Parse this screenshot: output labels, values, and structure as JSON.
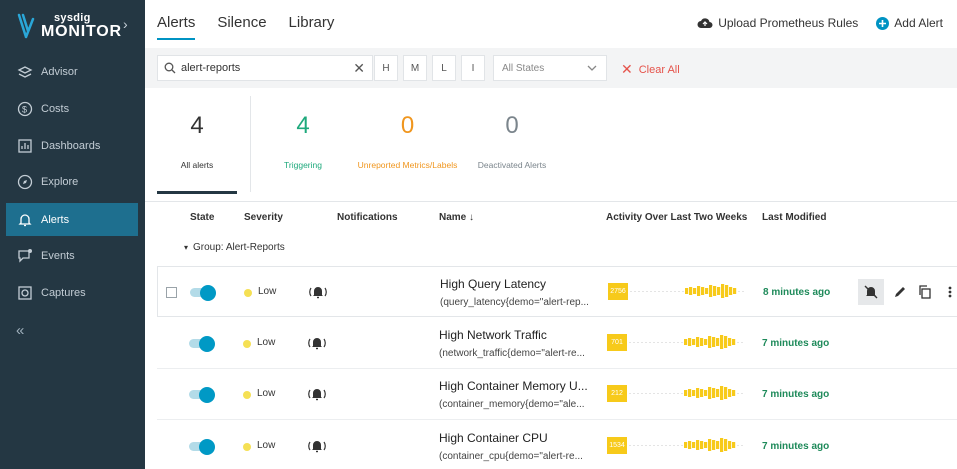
{
  "sidebar": {
    "brand_small": "sysdig",
    "brand_big": "MONITOR",
    "items": [
      {
        "label": "Advisor",
        "icon": "advisor-icon"
      },
      {
        "label": "Costs",
        "icon": "costs-icon"
      },
      {
        "label": "Dashboards",
        "icon": "dashboards-icon"
      },
      {
        "label": "Explore",
        "icon": "explore-icon"
      },
      {
        "label": "Alerts",
        "icon": "bell-icon",
        "active": true
      },
      {
        "label": "Events",
        "icon": "events-icon"
      },
      {
        "label": "Captures",
        "icon": "captures-icon"
      }
    ],
    "collapse": "«"
  },
  "tabs": [
    {
      "label": "Alerts",
      "active": true
    },
    {
      "label": "Silence"
    },
    {
      "label": "Library"
    }
  ],
  "actions": {
    "upload": "Upload Prometheus Rules",
    "add": "Add Alert"
  },
  "filters": {
    "search_value": "alert-reports",
    "severity_buttons": [
      "H",
      "M",
      "L",
      "I"
    ],
    "states_placeholder": "All States",
    "clear_all": "Clear All"
  },
  "summary": {
    "all": {
      "count": "4",
      "label": "All alerts"
    },
    "triggering": {
      "count": "4",
      "label": "Triggering"
    },
    "unreported": {
      "count": "0",
      "label": "Unreported Metrics/Labels"
    },
    "deactivated": {
      "count": "0",
      "label": "Deactivated Alerts"
    }
  },
  "table": {
    "headers": {
      "state": "State",
      "severity": "Severity",
      "notifications": "Notifications",
      "name": "Name ↓",
      "activity": "Activity Over Last Two Weeks",
      "modified": "Last Modified"
    },
    "group": "Group: Alert-Reports",
    "rows": [
      {
        "severity": "Low",
        "name": "High Query Latency",
        "query": "(query_latency{demo=\"alert-rep...",
        "activity_count": "2756",
        "modified": "8 minutes ago"
      },
      {
        "severity": "Low",
        "name": "High Network Traffic",
        "query": "(network_traffic{demo=\"alert-re...",
        "activity_count": "701",
        "modified": "7 minutes ago"
      },
      {
        "severity": "Low",
        "name": "High Container Memory U...",
        "query": "(container_memory{demo=\"ale...",
        "activity_count": "212",
        "modified": "7 minutes ago"
      },
      {
        "severity": "Low",
        "name": "High Container CPU",
        "query": "(container_cpu{demo=\"alert-re...",
        "activity_count": "1534",
        "modified": "7 minutes ago"
      }
    ]
  },
  "colors": {
    "sidebar_bg": "#243743",
    "accent": "#0093c3",
    "triggering": "#1ea97c",
    "unreported": "#f0961e",
    "activity": "#f7ca1a"
  }
}
